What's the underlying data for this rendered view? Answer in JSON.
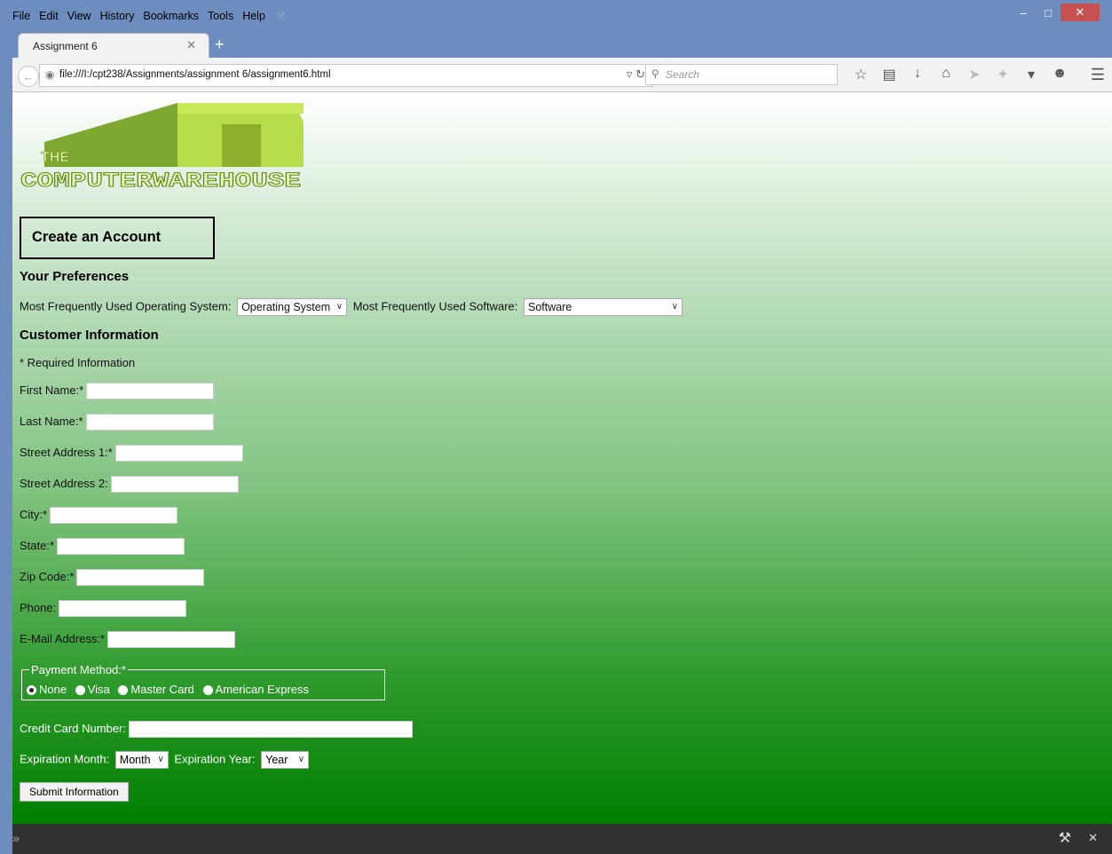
{
  "menu": [
    "File",
    "Edit",
    "View",
    "History",
    "Bookmarks",
    "Tools",
    "Help"
  ],
  "tab": {
    "title": "Assignment 6"
  },
  "nav": {
    "url": "file:///I:/cpt238/Assignments/assignment 6/assignment6.html",
    "search_placeholder": "Search"
  },
  "page": {
    "logo_text_top": "THE",
    "logo_text": "COMPUTERWAREHOUSE",
    "create_title": "Create an Account",
    "prefs_heading": "Your Preferences",
    "os_label": "Most Frequently Used Operating System:",
    "os_select": "Operating System",
    "sw_label": "Most Frequently Used Software:",
    "sw_select": "Software",
    "cust_heading": "Customer Information",
    "required_note": "* Required Information",
    "fields": {
      "first": "First Name:*",
      "last": "Last Name:*",
      "addr1": "Street Address 1:*",
      "addr2": "Street Address 2:",
      "city": "City:*",
      "state": "State:*",
      "zip": "Zip Code:*",
      "phone": "Phone:",
      "email": "E-Mail Address:*"
    },
    "payment": {
      "legend": "Payment Method:*",
      "options": [
        "None",
        "Visa",
        "Master Card",
        "American Express"
      ],
      "selected": "None"
    },
    "cc_label": "Credit Card Number:",
    "exp_month_label": "Expiration Month:",
    "exp_month_select": "Month",
    "exp_year_label": "Expiration Year:",
    "exp_year_select": "Year",
    "submit": "Submit Information"
  }
}
